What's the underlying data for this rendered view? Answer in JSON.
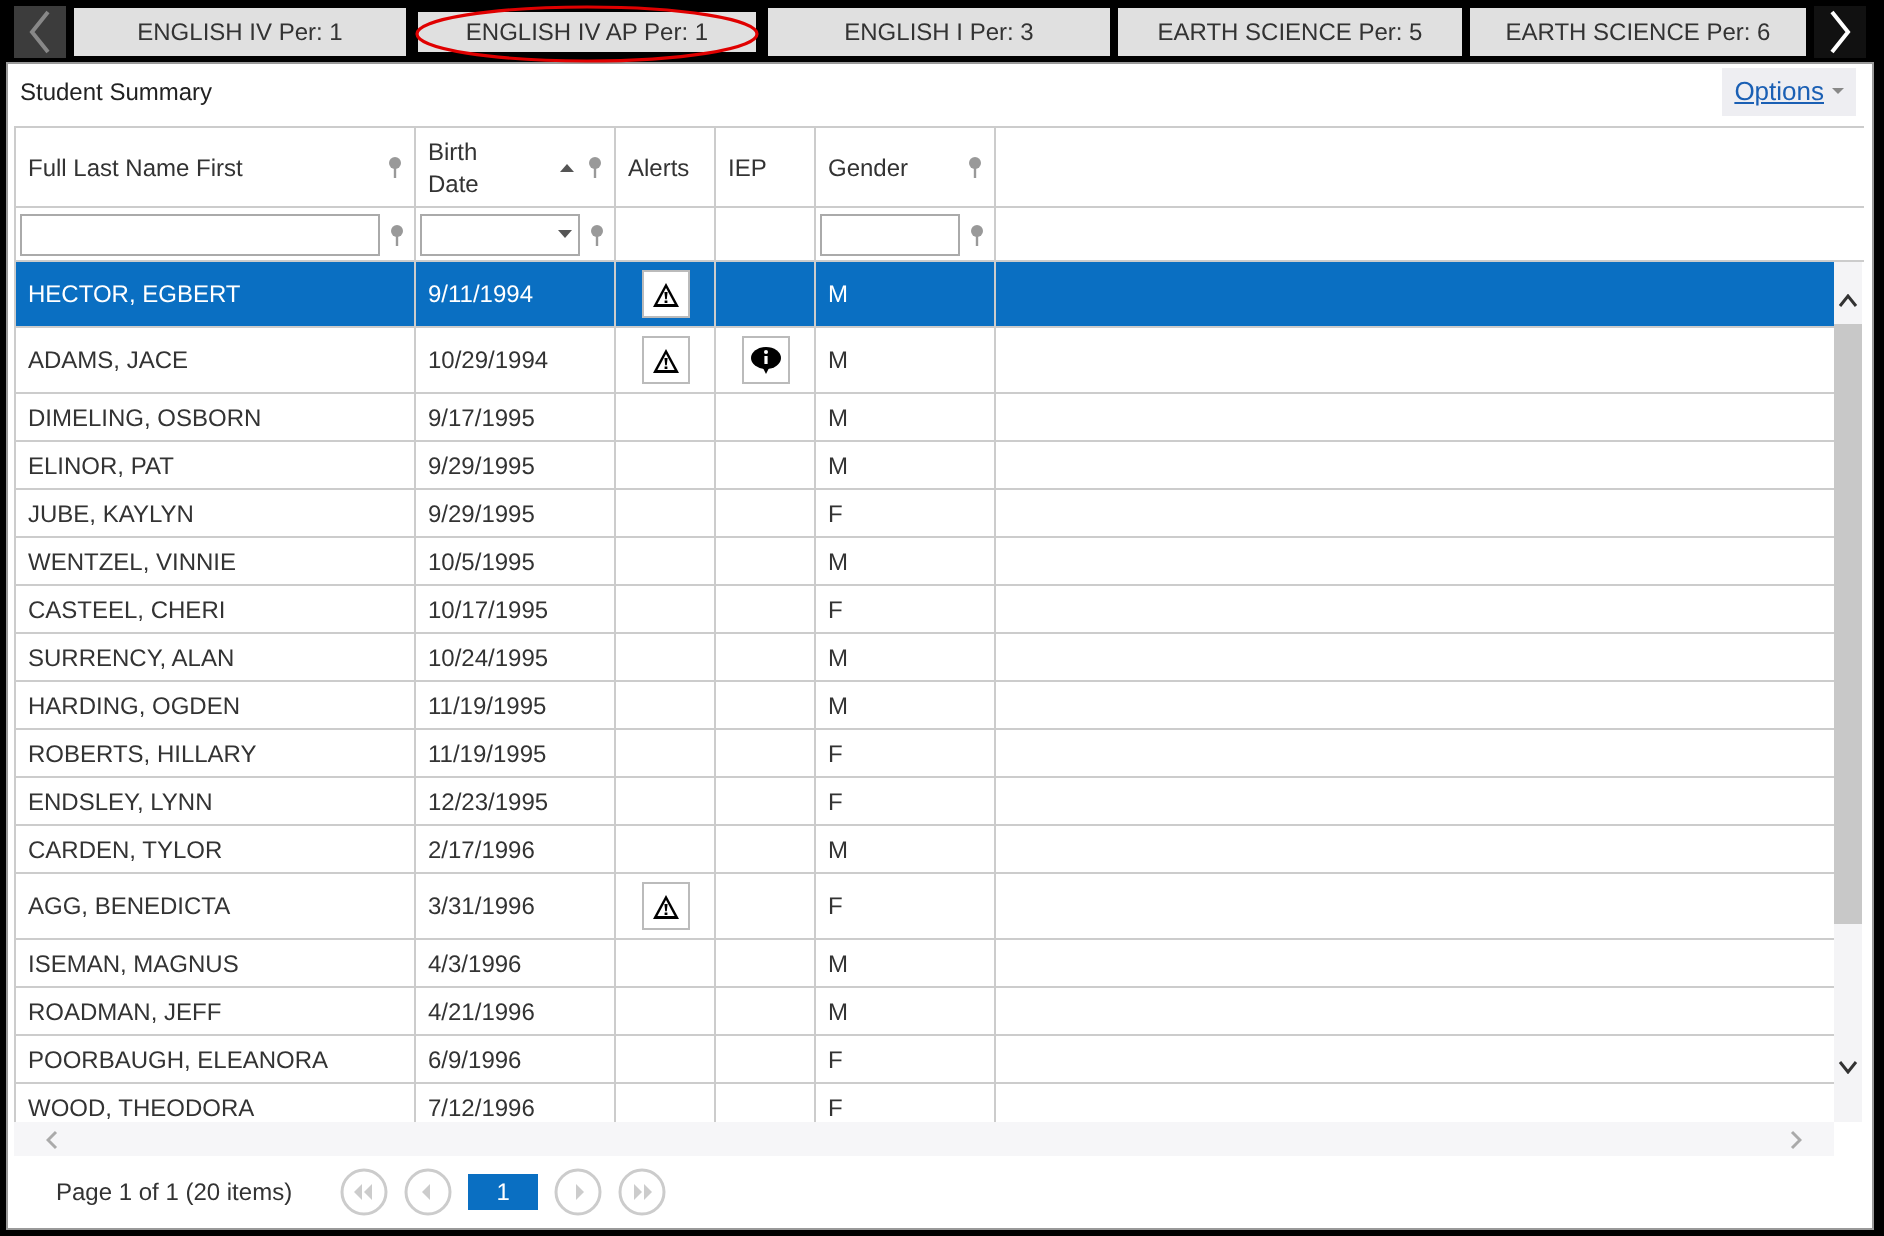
{
  "tabs": [
    {
      "label": "ENGLISH IV Per: 1",
      "selected": false
    },
    {
      "label": "ENGLISH IV AP Per: 1",
      "selected": true
    },
    {
      "label": "ENGLISH I Per: 3",
      "selected": false
    },
    {
      "label": "EARTH SCIENCE Per: 5",
      "selected": false
    },
    {
      "label": "EARTH SCIENCE Per: 6",
      "selected": false
    }
  ],
  "panel": {
    "title": "Student Summary",
    "options": "Options"
  },
  "columns": [
    {
      "label": "Full Last Name First",
      "kind": "textfilter",
      "sorted": false
    },
    {
      "label": "Birth Date",
      "kind": "dropdownfilter",
      "sorted": true
    },
    {
      "label": "Alerts",
      "kind": "plain",
      "sorted": false
    },
    {
      "label": "IEP",
      "kind": "plain",
      "sorted": false
    },
    {
      "label": "Gender",
      "kind": "textfilter",
      "sorted": false
    }
  ],
  "rows": [
    {
      "name": "HECTOR, EGBERT",
      "birth_date": "9/11/1994",
      "alert": true,
      "iep": false,
      "gender": "M",
      "selected": true
    },
    {
      "name": "ADAMS, JACE",
      "birth_date": "10/29/1994",
      "alert": true,
      "iep": true,
      "gender": "M",
      "selected": false
    },
    {
      "name": "DIMELING, OSBORN",
      "birth_date": "9/17/1995",
      "alert": false,
      "iep": false,
      "gender": "M",
      "selected": false
    },
    {
      "name": "ELINOR, PAT",
      "birth_date": "9/29/1995",
      "alert": false,
      "iep": false,
      "gender": "M",
      "selected": false
    },
    {
      "name": "JUBE, KAYLYN",
      "birth_date": "9/29/1995",
      "alert": false,
      "iep": false,
      "gender": "F",
      "selected": false
    },
    {
      "name": "WENTZEL, VINNIE",
      "birth_date": "10/5/1995",
      "alert": false,
      "iep": false,
      "gender": "M",
      "selected": false
    },
    {
      "name": "CASTEEL, CHERI",
      "birth_date": "10/17/1995",
      "alert": false,
      "iep": false,
      "gender": "F",
      "selected": false
    },
    {
      "name": "SURRENCY, ALAN",
      "birth_date": "10/24/1995",
      "alert": false,
      "iep": false,
      "gender": "M",
      "selected": false
    },
    {
      "name": "HARDING, OGDEN",
      "birth_date": "11/19/1995",
      "alert": false,
      "iep": false,
      "gender": "M",
      "selected": false
    },
    {
      "name": "ROBERTS, HILLARY",
      "birth_date": "11/19/1995",
      "alert": false,
      "iep": false,
      "gender": "F",
      "selected": false
    },
    {
      "name": "ENDSLEY, LYNN",
      "birth_date": "12/23/1995",
      "alert": false,
      "iep": false,
      "gender": "F",
      "selected": false
    },
    {
      "name": "CARDEN, TYLOR",
      "birth_date": "2/17/1996",
      "alert": false,
      "iep": false,
      "gender": "M",
      "selected": false
    },
    {
      "name": "AGG, BENEDICTA",
      "birth_date": "3/31/1996",
      "alert": true,
      "iep": false,
      "gender": "F",
      "selected": false
    },
    {
      "name": "ISEMAN, MAGNUS",
      "birth_date": "4/3/1996",
      "alert": false,
      "iep": false,
      "gender": "M",
      "selected": false
    },
    {
      "name": "ROADMAN, JEFF",
      "birth_date": "4/21/1996",
      "alert": false,
      "iep": false,
      "gender": "M",
      "selected": false
    },
    {
      "name": "POORBAUGH, ELEANORA",
      "birth_date": "6/9/1996",
      "alert": false,
      "iep": false,
      "gender": "F",
      "selected": false
    },
    {
      "name": "WOOD, THEODORA",
      "birth_date": "7/12/1996",
      "alert": false,
      "iep": false,
      "gender": "F",
      "selected": false
    }
  ],
  "pager": {
    "summary": "Page 1 of 1 (20 items)",
    "pages": [
      {
        "label": "1",
        "selected": true
      }
    ]
  }
}
